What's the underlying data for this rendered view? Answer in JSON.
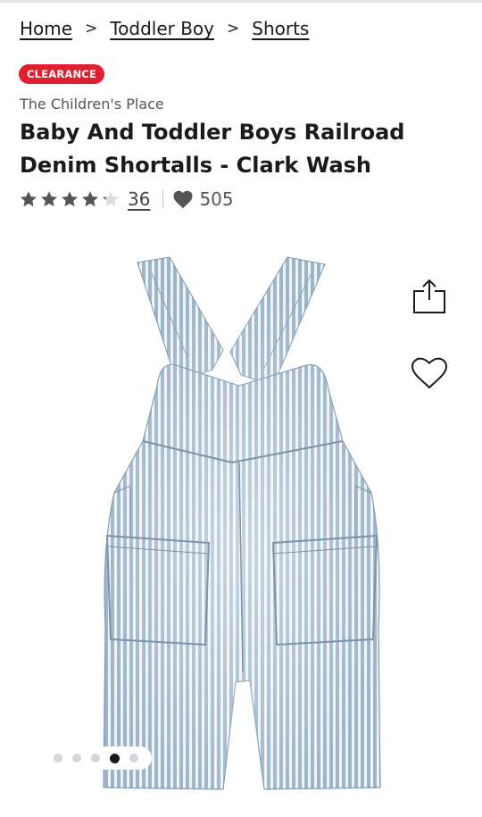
{
  "breadcrumb": {
    "items": [
      "Home",
      "Toddler Boy",
      "Shorts"
    ],
    "separator": ">"
  },
  "badge": {
    "label": "CLEARANCE",
    "color": "#e0202e"
  },
  "product": {
    "brand": "The Children's Place",
    "title": "Baby And Toddler Boys Railroad Denim Shortalls - Clark Wash",
    "rating": 4.2,
    "rating_max": 5,
    "review_count": "36",
    "favorites_count": "505"
  },
  "icons": {
    "share": "share-icon",
    "wishlist": "heart-outline-icon",
    "favorites": "heart-filled-icon",
    "star": "star-icon"
  },
  "carousel": {
    "total": 5,
    "active_index": 3
  }
}
